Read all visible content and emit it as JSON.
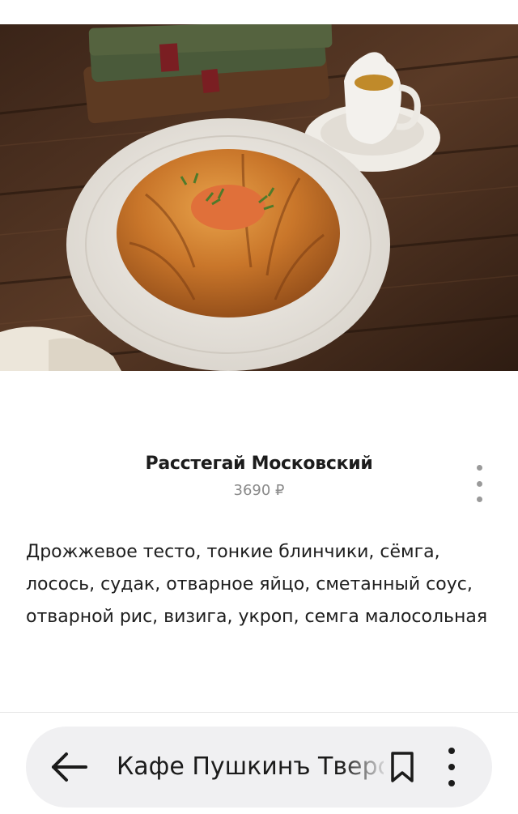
{
  "dish": {
    "image_alt": "Расстегай Московский",
    "title": "Расстегай Московский",
    "price": "3690 ₽",
    "description": "Дрожжевое тесто, тонкие блинчики, сёмга, лосось, судак, отварное яйцо, сметанный соус, отварной рис, визига, укроп, семга малосольная",
    "more_icon": "more-vertical-icon"
  },
  "browser_bar": {
    "back_icon": "arrow-left-icon",
    "tab_title": "Кафе Пушкинъ Тверской бульвар",
    "bookmark_icon": "bookmark-icon",
    "menu_icon": "more-vertical-icon"
  },
  "colors": {
    "background": "#ffffff",
    "title_text": "#1c1c1c",
    "price_text": "#8a8a8a",
    "bottom_bar_bg": "#f0f0f2"
  }
}
